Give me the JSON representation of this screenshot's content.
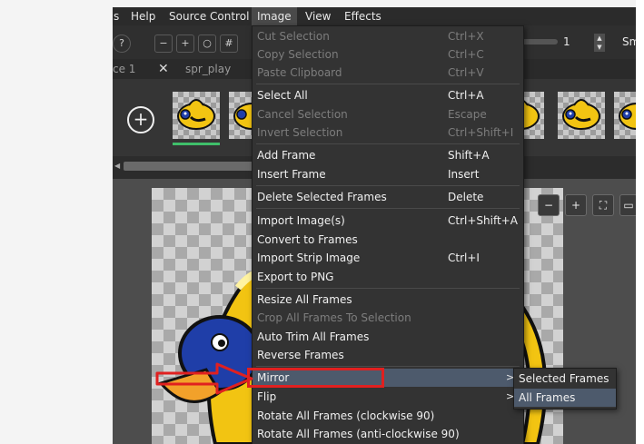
{
  "menubar": {
    "items": [
      {
        "label": "s"
      },
      {
        "label": "Help"
      },
      {
        "label": "Source Control"
      },
      {
        "label": "Image"
      },
      {
        "label": "View"
      },
      {
        "label": "Effects"
      }
    ]
  },
  "toolbar": {
    "frame_number": "1",
    "smooth_label": "Smo"
  },
  "tabs": {
    "partial_tab": "ce 1",
    "close_glyph": "✕",
    "sprite_tab": "spr_play"
  },
  "image_menu": {
    "items": [
      {
        "label": "Cut Selection",
        "shortcut": "Ctrl+X",
        "disabled": true
      },
      {
        "label": "Copy Selection",
        "shortcut": "Ctrl+C",
        "disabled": true
      },
      {
        "label": "Paste Clipboard",
        "shortcut": "Ctrl+V",
        "disabled": true
      },
      {
        "label": "Select All",
        "shortcut": "Ctrl+A"
      },
      {
        "label": "Cancel Selection",
        "shortcut": "Escape",
        "disabled": true
      },
      {
        "label": "Invert Selection",
        "shortcut": "Ctrl+Shift+I",
        "disabled": true
      },
      {
        "label": "Add Frame",
        "shortcut": "Shift+A"
      },
      {
        "label": "Insert Frame",
        "shortcut": "Insert"
      },
      {
        "label": "Delete Selected Frames",
        "shortcut": "Delete"
      },
      {
        "label": "Import Image(s)",
        "shortcut": "Ctrl+Shift+A"
      },
      {
        "label": "Convert to Frames",
        "shortcut": ""
      },
      {
        "label": "Import Strip Image",
        "shortcut": "Ctrl+I"
      },
      {
        "label": "Export to PNG",
        "shortcut": ""
      },
      {
        "label": "Resize All Frames",
        "shortcut": ""
      },
      {
        "label": "Crop All Frames To Selection",
        "shortcut": "",
        "disabled": true
      },
      {
        "label": "Auto Trim All Frames",
        "shortcut": ""
      },
      {
        "label": "Reverse Frames",
        "shortcut": ""
      },
      {
        "label": "Mirror",
        "shortcut": "",
        "submenu_arrow": ">",
        "highlighted": true
      },
      {
        "label": "Flip",
        "shortcut": "",
        "submenu_arrow": ">"
      },
      {
        "label": "Rotate All Frames (clockwise 90)",
        "shortcut": ""
      },
      {
        "label": "Rotate All Frames (anti-clockwise 90)",
        "shortcut": ""
      }
    ]
  },
  "mirror_submenu": {
    "items": [
      {
        "label": "Selected Frames"
      },
      {
        "label": "All Frames",
        "highlighted": true
      }
    ]
  },
  "colors": {
    "menu_bg": "#333333",
    "highlight": "#4d5a6c",
    "callout_red": "#e02020",
    "active_frame": "#3fbf6a"
  }
}
